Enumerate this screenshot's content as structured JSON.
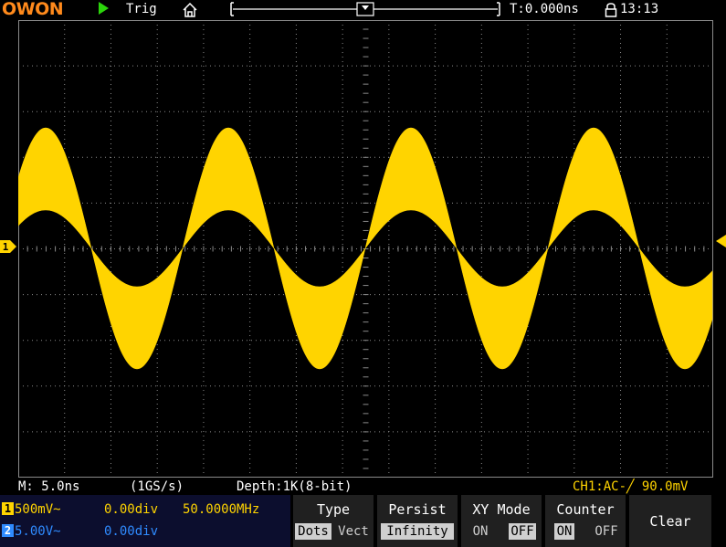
{
  "header": {
    "logo": "OWON",
    "trigger_status": "Trig",
    "time_offset": "T:0.000ns",
    "clock": "13:13"
  },
  "status": {
    "timebase": "M: 5.0ns",
    "sample_rate": "(1GS/s)",
    "depth": "Depth:1K(8-bit)",
    "trigger_info": "CH1:AC-╱ 90.0mV"
  },
  "channels": [
    {
      "num": "1",
      "scale": "500mV~",
      "offset": "0.00div",
      "freq": "50.0000MHz",
      "color": "#ffd400"
    },
    {
      "num": "2",
      "scale": "5.00V~",
      "offset": "0.00div",
      "freq": "",
      "color": "#2f8bff"
    }
  ],
  "menu": {
    "type": {
      "title": "Type",
      "opt1": "Dots",
      "opt2": "Vect"
    },
    "persist": {
      "title": "Persist",
      "value": "Infinity"
    },
    "xy": {
      "title": "XY Mode",
      "opt1": "ON",
      "opt2": "OFF"
    },
    "counter": {
      "title": "Counter",
      "opt1": "ON",
      "opt2": "OFF"
    },
    "clear": {
      "title": "Clear"
    }
  },
  "colors": {
    "ch1": "#ffd400",
    "ch2": "#2f8bff",
    "grid": "#8a8a8a",
    "logo": "#ff8a1c",
    "run": "#2bd40b"
  },
  "icons": {
    "run": "run-triangle-icon",
    "home": "home-icon",
    "lock": "lock-icon"
  }
}
